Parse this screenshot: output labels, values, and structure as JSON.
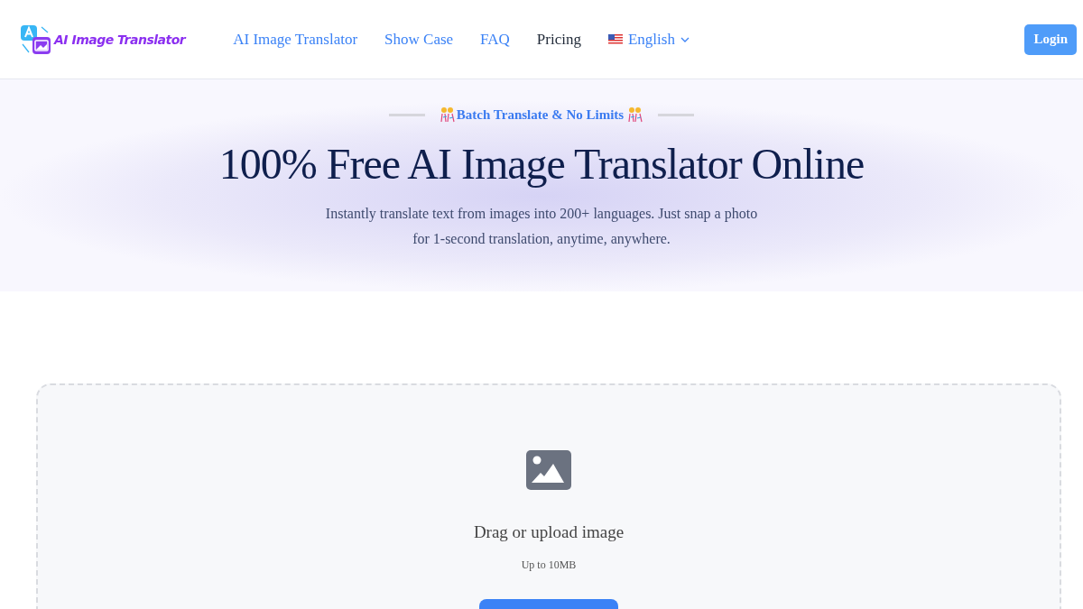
{
  "header": {
    "logo_text": "AI Image Translator",
    "nav": [
      {
        "label": "AI Image Translator",
        "selected": false
      },
      {
        "label": "Show Case",
        "selected": false
      },
      {
        "label": "FAQ",
        "selected": false
      },
      {
        "label": "Pricing",
        "selected": true
      }
    ],
    "language": "English",
    "login": "Login"
  },
  "hero": {
    "badge": "Batch Translate & No Limits",
    "title": "100% Free AI Image Translator Online",
    "subtitle_lines": [
      "Instantly translate text from images into 200+ languages. Just snap a photo",
      "for 1-second translation, anytime, anywhere."
    ]
  },
  "upload": {
    "prompt": "Drag or upload image",
    "limit": "Up to 10MB",
    "button": {
      "kind": "primary"
    }
  }
}
